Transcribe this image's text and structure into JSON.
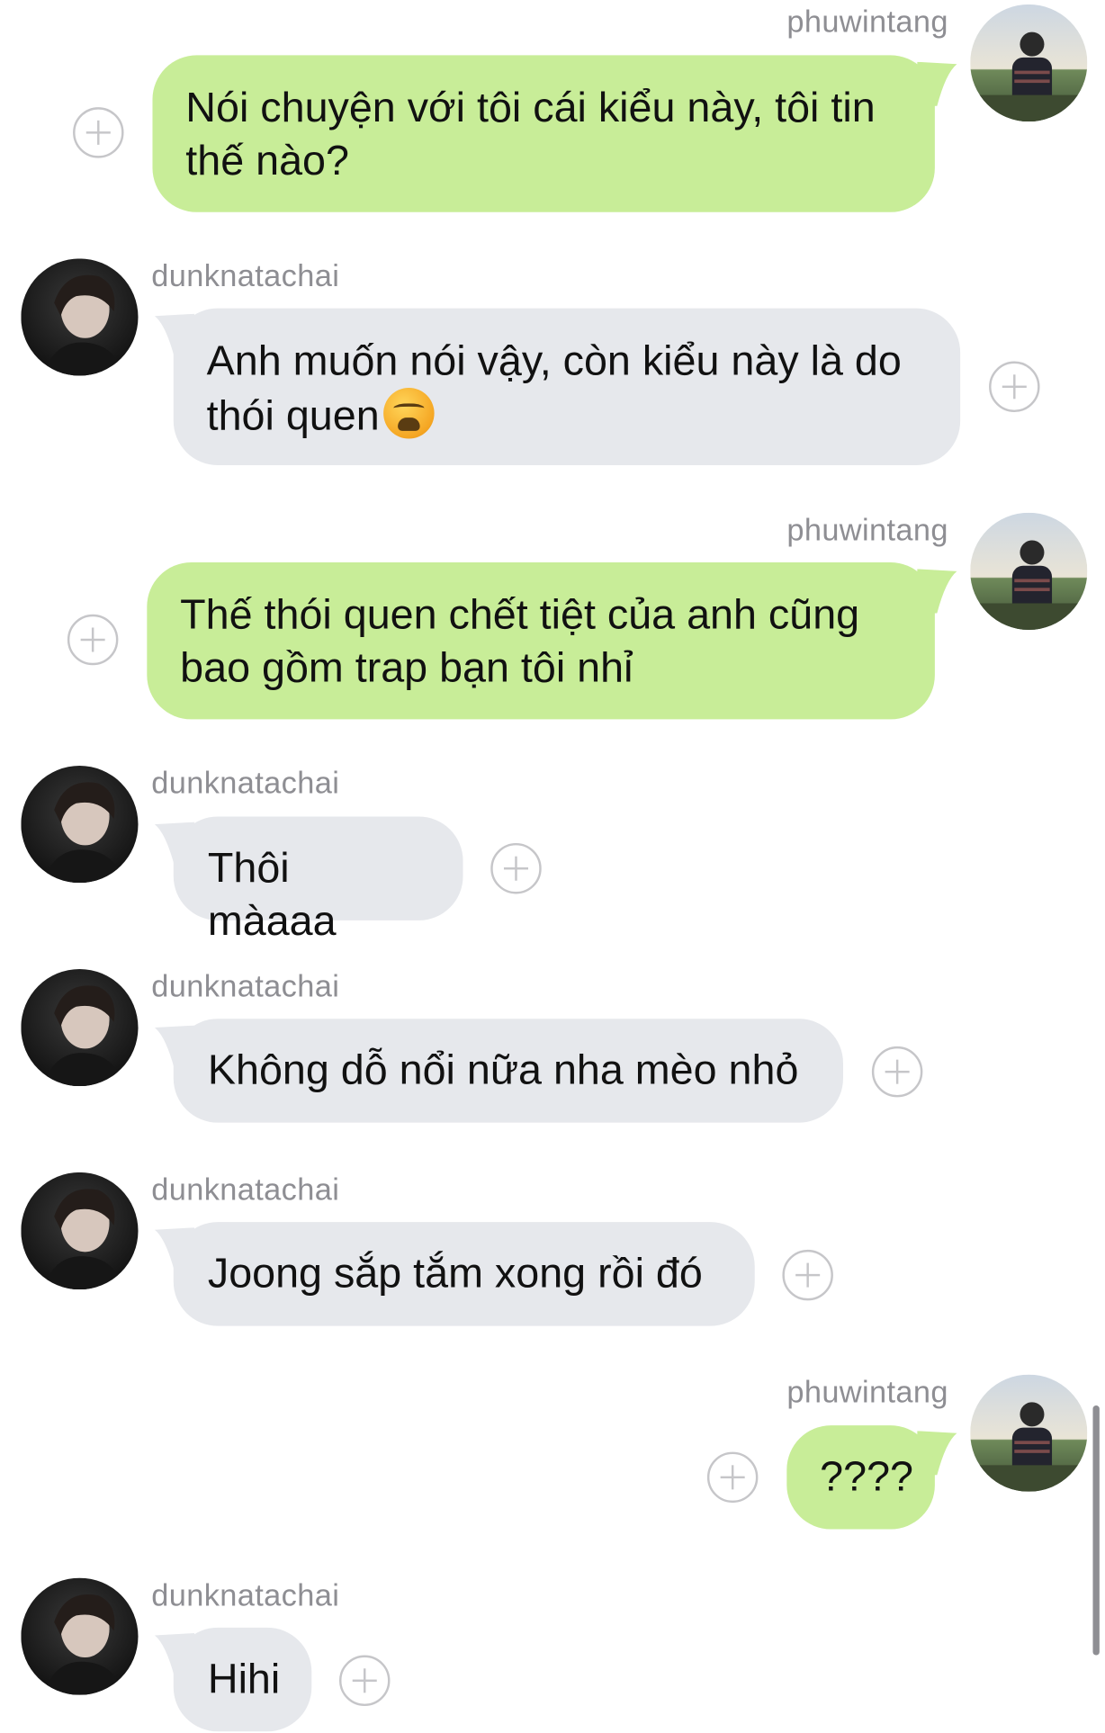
{
  "chat": {
    "messages": [
      {
        "sender": "phuwintang",
        "text": "Nói chuyện với tôi cái kiểu này, tôi tin thế nào?"
      },
      {
        "sender": "dunknatachai",
        "text": "Anh muốn nói vậy, còn kiểu này là do thói quen",
        "emoji": "weary-face"
      },
      {
        "sender": "phuwintang",
        "text": "Thế thói quen chết tiệt của anh cũng bao gồm trap bạn tôi nhỉ"
      },
      {
        "sender": "dunknatachai",
        "text": "Thôi màaaa"
      },
      {
        "sender": "dunknatachai",
        "text": "Không dỗ nổi nữa nha mèo nhỏ"
      },
      {
        "sender": "dunknatachai",
        "text": "Joong sắp tắm xong rồi đó"
      },
      {
        "sender": "phuwintang",
        "text": "????"
      },
      {
        "sender": "dunknatachai",
        "text": "Hihi"
      }
    ]
  },
  "colors": {
    "mine_bubble": "#c8ed98",
    "their_bubble": "#e6e8ec",
    "username": "#8e8e93",
    "add_reaction": "#c6c6c9"
  },
  "icons": {
    "reaction": "plus-circle-icon",
    "avatar_me": "avatar-phuwintang",
    "avatar_them": "avatar-dunknatachai"
  }
}
